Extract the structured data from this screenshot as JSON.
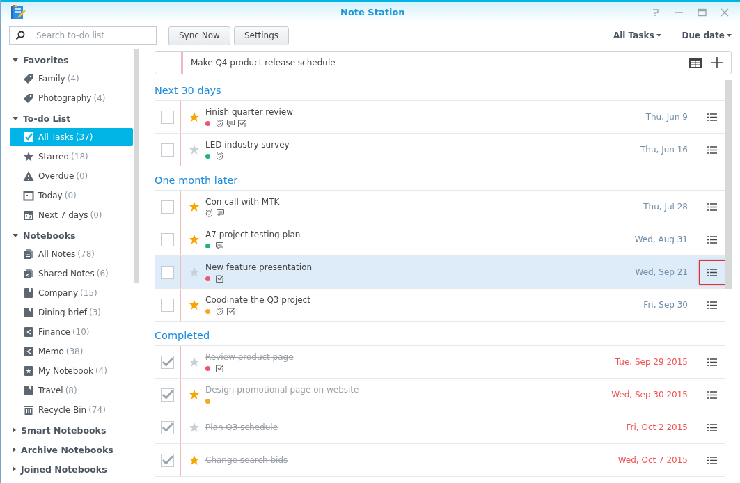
{
  "window": {
    "title": "Note Station"
  },
  "toolbar": {
    "search": {
      "placeholder": "Search to-do list"
    },
    "buttons": [
      "Sync Now",
      "Settings"
    ],
    "filter": "All Tasks",
    "sort": "Due date"
  },
  "sidebar": {
    "sections": [
      {
        "title": "Favorites",
        "expanded": true,
        "items": [
          {
            "kind": "tag",
            "label": "Family",
            "count": "(4)",
            "selected": false
          },
          {
            "kind": "tag",
            "label": "Photography",
            "count": "(4)",
            "selected": false
          }
        ]
      },
      {
        "title": "To-do List",
        "expanded": true,
        "items": [
          {
            "kind": "check",
            "label": "All Tasks",
            "count": "(37)",
            "selected": true
          },
          {
            "kind": "star",
            "label": "Starred",
            "count": "(18)",
            "selected": false
          },
          {
            "kind": "warning",
            "label": "Overdue",
            "count": "(0)",
            "selected": false
          },
          {
            "kind": "calendar",
            "label": "Today",
            "count": "(0)",
            "selected": false
          },
          {
            "kind": "calendar7",
            "label": "Next 7 days",
            "count": "(0)",
            "selected": false
          }
        ]
      },
      {
        "title": "Notebooks",
        "expanded": true,
        "items": [
          {
            "kind": "notes",
            "label": "All Notes",
            "count": "(78)",
            "selected": false
          },
          {
            "kind": "shared-notes",
            "label": "Shared Notes",
            "count": "(6)",
            "selected": false
          },
          {
            "kind": "notebook",
            "label": "Company",
            "count": "(15)",
            "selected": false
          },
          {
            "kind": "notebook",
            "label": "Dining brief",
            "count": "(3)",
            "selected": false
          },
          {
            "kind": "shared-notebook",
            "label": "Finance",
            "count": "(10)",
            "selected": false
          },
          {
            "kind": "shared-notebook",
            "label": "Memo",
            "count": "(38)",
            "selected": false
          },
          {
            "kind": "star-notebook",
            "label": "My Notebook",
            "count": "(4)",
            "selected": false
          },
          {
            "kind": "notebook",
            "label": "Travel",
            "count": "(8)",
            "selected": false
          },
          {
            "kind": "trash",
            "label": "Recycle Bin",
            "count": "(74)",
            "selected": false
          }
        ]
      },
      {
        "title": "Smart Notebooks",
        "expanded": false
      },
      {
        "title": "Archive Notebooks",
        "expanded": false
      },
      {
        "title": "Joined Notebooks",
        "expanded": false
      }
    ]
  },
  "quick_add": {
    "value": "Make Q4 product release schedule"
  },
  "groups": [
    {
      "title": "Next 30 days",
      "tasks": [
        {
          "title": "Finish quarter review",
          "done": false,
          "starred": true,
          "selected": false,
          "menu_highlighted": false,
          "color": "#f0566a",
          "badges": [
            {
              "kind": "reminder"
            },
            {
              "kind": "comment"
            },
            {
              "kind": "checklist"
            }
          ],
          "due": "Thu, Jun 9",
          "overdue": false
        },
        {
          "title": "LED industry survey",
          "done": false,
          "starred": false,
          "selected": false,
          "menu_highlighted": false,
          "color": "#20b37a",
          "badges": [
            {
              "kind": "reminder"
            }
          ],
          "due": "Thu, Jun 16",
          "overdue": false
        }
      ]
    },
    {
      "title": "One month later",
      "tasks": [
        {
          "title": "Con call with MTK",
          "done": false,
          "starred": true,
          "selected": false,
          "menu_highlighted": false,
          "badges": [
            {
              "kind": "reminder"
            },
            {
              "kind": "comment"
            }
          ],
          "due": "Thu, Jul 28",
          "overdue": false
        },
        {
          "title": "A7 project testing plan",
          "done": false,
          "starred": true,
          "selected": false,
          "menu_highlighted": false,
          "color": "#20b37a",
          "badges": [
            {
              "kind": "comment"
            }
          ],
          "due": "Wed, Aug 31",
          "overdue": false
        },
        {
          "title": "New feature presentation",
          "done": false,
          "starred": false,
          "selected": true,
          "menu_highlighted": true,
          "color": "#f0566a",
          "badges": [
            {
              "kind": "checklist"
            }
          ],
          "due": "Wed, Sep 21",
          "overdue": false
        },
        {
          "title": "Coodinate the Q3 project",
          "done": false,
          "starred": true,
          "selected": false,
          "menu_highlighted": false,
          "color": "#f5a623",
          "badges": [
            {
              "kind": "reminder"
            },
            {
              "kind": "checklist"
            }
          ],
          "due": "Fri, Sep 30",
          "overdue": false
        }
      ]
    },
    {
      "title": "Completed",
      "tasks": [
        {
          "title": "Review product page",
          "done": true,
          "starred": false,
          "selected": false,
          "menu_highlighted": false,
          "color": "#f0566a",
          "badges": [
            {
              "kind": "checklist"
            }
          ],
          "due": "Tue, Sep 29 2015",
          "overdue": true
        },
        {
          "title": "Design promotional page on website",
          "done": true,
          "starred": true,
          "selected": false,
          "menu_highlighted": false,
          "color": "#f5a623",
          "due": "Wed, Sep 30 2015",
          "overdue": true
        },
        {
          "title": "Plan Q3 schedule",
          "done": true,
          "starred": false,
          "selected": false,
          "menu_highlighted": false,
          "due": "Fri, Oct 2 2015",
          "overdue": true
        },
        {
          "title": "Change search bids",
          "done": true,
          "starred": true,
          "selected": false,
          "menu_highlighted": false,
          "due": "Wed, Oct 7 2015",
          "overdue": true
        }
      ]
    }
  ]
}
